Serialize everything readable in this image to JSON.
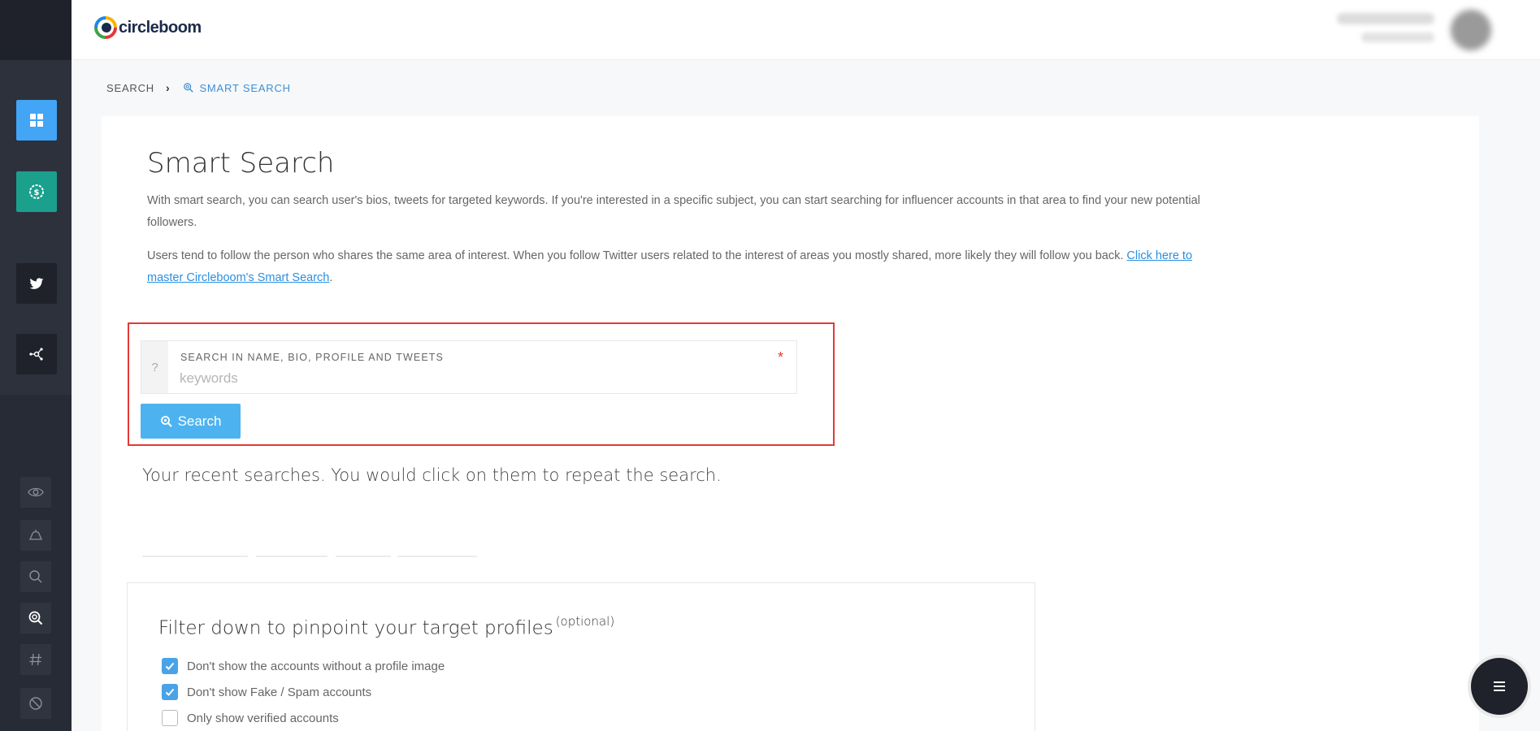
{
  "app": {
    "logo_text": "circleboom"
  },
  "breadcrumb": {
    "root": "SEARCH",
    "current": "SMART SEARCH"
  },
  "page": {
    "title": "Smart Search",
    "description_1": "With smart search, you can search user's bios, tweets for targeted keywords. If you're interested in a specific subject, you can start searching for influencer accounts in that area to find your new potential followers.",
    "description_2_text": "Users tend to follow the person who shares the same area of interest. When you follow Twitter users related to the interest of areas you mostly shared, more likely they will follow you back. ",
    "description_2_link": "Click here to master Circleboom's Smart Search",
    "description_2_end": "."
  },
  "search": {
    "help_glyph": "?",
    "label": "SEARCH IN NAME, BIO, PROFILE AND TWEETS",
    "placeholder": "keywords",
    "value": "",
    "required_mark": "*",
    "button_label": "Search"
  },
  "recent": {
    "text": "Your recent searches. You would click on them to repeat the search."
  },
  "filter": {
    "title": "Filter down to pinpoint your target profiles",
    "title_note": "(optional)",
    "options": [
      {
        "label": "Don't show the accounts without a profile image",
        "checked": true
      },
      {
        "label": "Don't show Fake / Spam accounts",
        "checked": true
      },
      {
        "label": "Only show verified accounts",
        "checked": false
      }
    ]
  },
  "colors": {
    "sidebar_dashboard": "#42a5f5",
    "sidebar_pricing": "#1aa08d",
    "accent": "#4db3f0",
    "highlight": "#e53935"
  },
  "icons": {
    "sidebar": [
      "dashboard-icon",
      "dollar-gear-icon",
      "twitter-icon",
      "network-icon",
      "eye-icon",
      "bell-icon",
      "search-icon",
      "smart-search-icon",
      "hashtag-icon",
      "block-icon"
    ],
    "fab": "menu-icon"
  }
}
